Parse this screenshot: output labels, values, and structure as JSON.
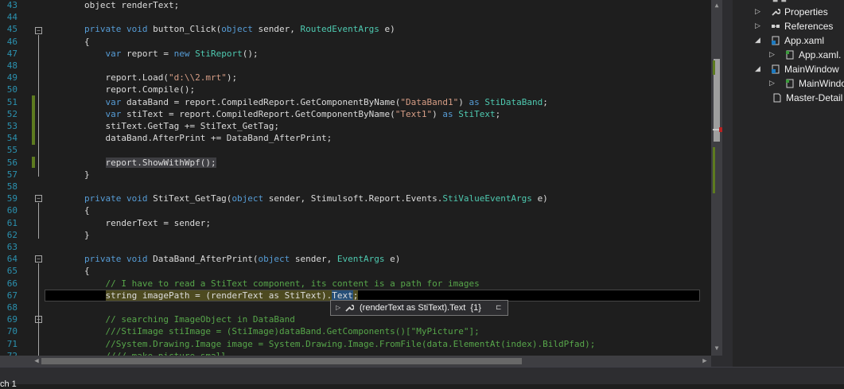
{
  "line_numbers": [
    "43",
    "44",
    "45",
    "46",
    "47",
    "48",
    "49",
    "50",
    "51",
    "52",
    "53",
    "54",
    "55",
    "56",
    "57",
    "58",
    "59",
    "60",
    "61",
    "62",
    "63",
    "64",
    "65",
    "66",
    "67",
    "68",
    "69",
    "70",
    "71",
    "72"
  ],
  "code": {
    "l43": [
      {
        "t": "object renderText;",
        "c": ""
      }
    ],
    "l45": [
      {
        "t": "private void ",
        "c": "kw"
      },
      {
        "t": "button_Click(",
        "c": ""
      },
      {
        "t": "object ",
        "c": "kw"
      },
      {
        "t": "sender, ",
        "c": ""
      },
      {
        "t": "RoutedEventArgs ",
        "c": "ty"
      },
      {
        "t": "e)",
        "c": ""
      }
    ],
    "l46": [
      {
        "t": "{",
        "c": ""
      }
    ],
    "l47": [
      {
        "t": "    ",
        "c": ""
      },
      {
        "t": "var ",
        "c": "kw"
      },
      {
        "t": "report = ",
        "c": ""
      },
      {
        "t": "new ",
        "c": "kw"
      },
      {
        "t": "StiReport",
        "c": "ty"
      },
      {
        "t": "();",
        "c": ""
      }
    ],
    "l49": [
      {
        "t": "    report.Load(",
        "c": ""
      },
      {
        "t": "\"d:\\\\2.mrt\"",
        "c": "st"
      },
      {
        "t": ");",
        "c": ""
      }
    ],
    "l50": [
      {
        "t": "    report.Compile();",
        "c": ""
      }
    ],
    "l51": [
      {
        "t": "    ",
        "c": ""
      },
      {
        "t": "var ",
        "c": "kw"
      },
      {
        "t": "dataBand = report.CompiledReport.GetComponentByName(",
        "c": ""
      },
      {
        "t": "\"DataBand1\"",
        "c": "st"
      },
      {
        "t": ") ",
        "c": ""
      },
      {
        "t": "as ",
        "c": "kw"
      },
      {
        "t": "StiDataBand",
        "c": "ty"
      },
      {
        "t": ";",
        "c": ""
      }
    ],
    "l52": [
      {
        "t": "    ",
        "c": ""
      },
      {
        "t": "var ",
        "c": "kw"
      },
      {
        "t": "stiText = report.CompiledReport.GetComponentByName(",
        "c": ""
      },
      {
        "t": "\"Text1\"",
        "c": "st"
      },
      {
        "t": ") ",
        "c": ""
      },
      {
        "t": "as ",
        "c": "kw"
      },
      {
        "t": "StiText",
        "c": "ty"
      },
      {
        "t": ";",
        "c": ""
      }
    ],
    "l53": [
      {
        "t": "    stiText.GetTag += StiText_GetTag;",
        "c": ""
      }
    ],
    "l54": [
      {
        "t": "    dataBand.AfterPrint += DataBand_AfterPrint;",
        "c": ""
      }
    ],
    "l56": [
      {
        "t": "    ",
        "c": ""
      },
      {
        "t": "report.ShowWithWpf();",
        "c": "sel"
      }
    ],
    "l57": [
      {
        "t": "}",
        "c": ""
      }
    ],
    "l59": [
      {
        "t": "private void ",
        "c": "kw"
      },
      {
        "t": "StiText_GetTag(",
        "c": ""
      },
      {
        "t": "object ",
        "c": "kw"
      },
      {
        "t": "sender, Stimulsoft.Report.Events.",
        "c": ""
      },
      {
        "t": "StiValueEventArgs ",
        "c": "ty"
      },
      {
        "t": "e)",
        "c": ""
      }
    ],
    "l60": [
      {
        "t": "{",
        "c": ""
      }
    ],
    "l61": [
      {
        "t": "    renderText = sender;",
        "c": ""
      }
    ],
    "l62": [
      {
        "t": "}",
        "c": ""
      }
    ],
    "l64": [
      {
        "t": "private void ",
        "c": "kw"
      },
      {
        "t": "DataBand_AfterPrint(",
        "c": ""
      },
      {
        "t": "object ",
        "c": "kw"
      },
      {
        "t": "sender, ",
        "c": ""
      },
      {
        "t": "EventArgs ",
        "c": "ty"
      },
      {
        "t": "e)",
        "c": ""
      }
    ],
    "l65": [
      {
        "t": "{",
        "c": ""
      }
    ],
    "l66": [
      {
        "t": "    // I have to read a StiText component, its content is a path for images",
        "c": "cm"
      }
    ],
    "l67": [
      {
        "t": "    ",
        "c": ""
      },
      {
        "t": "string imagePath = (renderText as StiText).",
        "c": "hl"
      },
      {
        "t": "Text",
        "c": "hlsel"
      },
      {
        "t": ";",
        "c": "hl"
      }
    ],
    "l69": [
      {
        "t": "    // searching ImageObject in DataBand",
        "c": "cm"
      }
    ],
    "l70": [
      {
        "t": "    ///StiImage stiImage = (StiImage)dataBand.GetComponents()[\"MyPicture\"];",
        "c": "cm"
      }
    ],
    "l71": [
      {
        "t": "    //System.Drawing.Image image = System.Drawing.Image.FromFile(data.ElementAt(index).BildPfad);",
        "c": "cm"
      }
    ],
    "l72": [
      {
        "t": "    ////_make_picture_small",
        "c": "cm"
      }
    ]
  },
  "tooltip": {
    "expression": "(renderText as StiText).Text",
    "value": "{1}",
    "icon": "wrench-icon"
  },
  "solution_explorer": [
    {
      "label": "Properties",
      "icon": "wrench-icon"
    },
    {
      "label": "References",
      "icon": "references-icon"
    },
    {
      "label": "App.xaml",
      "icon": "xaml-file-icon"
    },
    {
      "label": "App.xaml.",
      "icon": "cs-file-icon"
    },
    {
      "label": "MainWindow",
      "icon": "xaml-file-icon"
    },
    {
      "label": "MainWindo",
      "icon": "cs-file-icon"
    },
    {
      "label": "Master-Detail",
      "icon": "file-icon"
    }
  ],
  "status": {
    "text": "ch 1"
  }
}
